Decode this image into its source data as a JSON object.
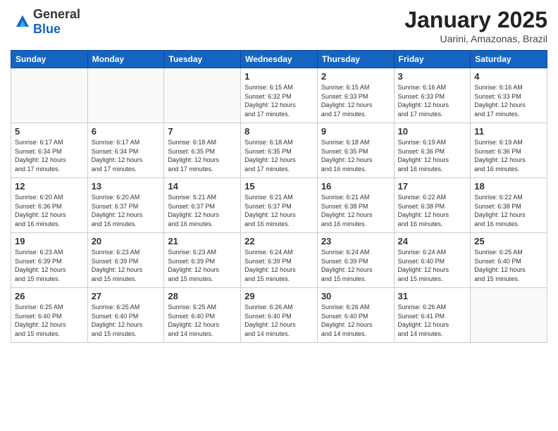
{
  "header": {
    "logo": {
      "general": "General",
      "blue": "Blue"
    },
    "title": "January 2025",
    "subtitle": "Uarini, Amazonas, Brazil"
  },
  "days_of_week": [
    "Sunday",
    "Monday",
    "Tuesday",
    "Wednesday",
    "Thursday",
    "Friday",
    "Saturday"
  ],
  "weeks": [
    [
      {
        "day": "",
        "info": ""
      },
      {
        "day": "",
        "info": ""
      },
      {
        "day": "",
        "info": ""
      },
      {
        "day": "1",
        "info": "Sunrise: 6:15 AM\nSunset: 6:32 PM\nDaylight: 12 hours\nand 17 minutes."
      },
      {
        "day": "2",
        "info": "Sunrise: 6:15 AM\nSunset: 6:33 PM\nDaylight: 12 hours\nand 17 minutes."
      },
      {
        "day": "3",
        "info": "Sunrise: 6:16 AM\nSunset: 6:33 PM\nDaylight: 12 hours\nand 17 minutes."
      },
      {
        "day": "4",
        "info": "Sunrise: 6:16 AM\nSunset: 6:33 PM\nDaylight: 12 hours\nand 17 minutes."
      }
    ],
    [
      {
        "day": "5",
        "info": "Sunrise: 6:17 AM\nSunset: 6:34 PM\nDaylight: 12 hours\nand 17 minutes."
      },
      {
        "day": "6",
        "info": "Sunrise: 6:17 AM\nSunset: 6:34 PM\nDaylight: 12 hours\nand 17 minutes."
      },
      {
        "day": "7",
        "info": "Sunrise: 6:18 AM\nSunset: 6:35 PM\nDaylight: 12 hours\nand 17 minutes."
      },
      {
        "day": "8",
        "info": "Sunrise: 6:18 AM\nSunset: 6:35 PM\nDaylight: 12 hours\nand 17 minutes."
      },
      {
        "day": "9",
        "info": "Sunrise: 6:18 AM\nSunset: 6:35 PM\nDaylight: 12 hours\nand 16 minutes."
      },
      {
        "day": "10",
        "info": "Sunrise: 6:19 AM\nSunset: 6:36 PM\nDaylight: 12 hours\nand 16 minutes."
      },
      {
        "day": "11",
        "info": "Sunrise: 6:19 AM\nSunset: 6:36 PM\nDaylight: 12 hours\nand 16 minutes."
      }
    ],
    [
      {
        "day": "12",
        "info": "Sunrise: 6:20 AM\nSunset: 6:36 PM\nDaylight: 12 hours\nand 16 minutes."
      },
      {
        "day": "13",
        "info": "Sunrise: 6:20 AM\nSunset: 6:37 PM\nDaylight: 12 hours\nand 16 minutes."
      },
      {
        "day": "14",
        "info": "Sunrise: 6:21 AM\nSunset: 6:37 PM\nDaylight: 12 hours\nand 16 minutes."
      },
      {
        "day": "15",
        "info": "Sunrise: 6:21 AM\nSunset: 6:37 PM\nDaylight: 12 hours\nand 16 minutes."
      },
      {
        "day": "16",
        "info": "Sunrise: 6:21 AM\nSunset: 6:38 PM\nDaylight: 12 hours\nand 16 minutes."
      },
      {
        "day": "17",
        "info": "Sunrise: 6:22 AM\nSunset: 6:38 PM\nDaylight: 12 hours\nand 16 minutes."
      },
      {
        "day": "18",
        "info": "Sunrise: 6:22 AM\nSunset: 6:38 PM\nDaylight: 12 hours\nand 16 minutes."
      }
    ],
    [
      {
        "day": "19",
        "info": "Sunrise: 6:23 AM\nSunset: 6:39 PM\nDaylight: 12 hours\nand 15 minutes."
      },
      {
        "day": "20",
        "info": "Sunrise: 6:23 AM\nSunset: 6:39 PM\nDaylight: 12 hours\nand 15 minutes."
      },
      {
        "day": "21",
        "info": "Sunrise: 6:23 AM\nSunset: 6:39 PM\nDaylight: 12 hours\nand 15 minutes."
      },
      {
        "day": "22",
        "info": "Sunrise: 6:24 AM\nSunset: 6:39 PM\nDaylight: 12 hours\nand 15 minutes."
      },
      {
        "day": "23",
        "info": "Sunrise: 6:24 AM\nSunset: 6:39 PM\nDaylight: 12 hours\nand 15 minutes."
      },
      {
        "day": "24",
        "info": "Sunrise: 6:24 AM\nSunset: 6:40 PM\nDaylight: 12 hours\nand 15 minutes."
      },
      {
        "day": "25",
        "info": "Sunrise: 6:25 AM\nSunset: 6:40 PM\nDaylight: 12 hours\nand 15 minutes."
      }
    ],
    [
      {
        "day": "26",
        "info": "Sunrise: 6:25 AM\nSunset: 6:40 PM\nDaylight: 12 hours\nand 15 minutes."
      },
      {
        "day": "27",
        "info": "Sunrise: 6:25 AM\nSunset: 6:40 PM\nDaylight: 12 hours\nand 15 minutes."
      },
      {
        "day": "28",
        "info": "Sunrise: 6:25 AM\nSunset: 6:40 PM\nDaylight: 12 hours\nand 14 minutes."
      },
      {
        "day": "29",
        "info": "Sunrise: 6:26 AM\nSunset: 6:40 PM\nDaylight: 12 hours\nand 14 minutes."
      },
      {
        "day": "30",
        "info": "Sunrise: 6:26 AM\nSunset: 6:40 PM\nDaylight: 12 hours\nand 14 minutes."
      },
      {
        "day": "31",
        "info": "Sunrise: 6:26 AM\nSunset: 6:41 PM\nDaylight: 12 hours\nand 14 minutes."
      },
      {
        "day": "",
        "info": ""
      }
    ]
  ]
}
